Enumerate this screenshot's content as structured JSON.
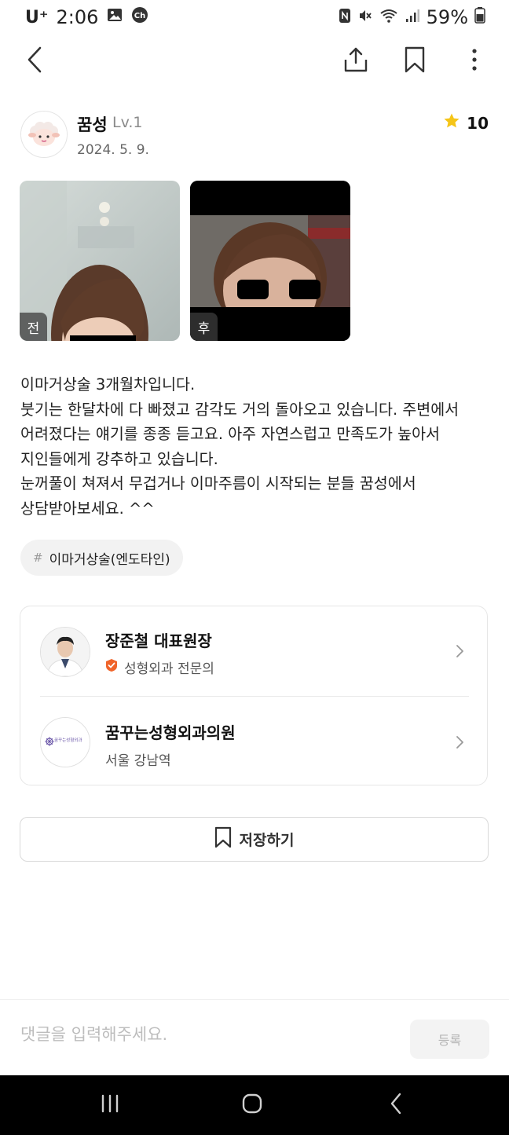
{
  "status_bar": {
    "carrier": "U⁺",
    "time": "2:06",
    "battery": "59%",
    "icons": [
      "gallery-icon",
      "channel-icon",
      "nfc-icon",
      "mute-icon",
      "wifi-icon",
      "signal-icon",
      "battery-icon"
    ]
  },
  "top_bar": {
    "icons": [
      "back-arrow-icon",
      "share-icon",
      "bookmark-icon",
      "more-vertical-icon"
    ]
  },
  "author": {
    "name": "꿈성",
    "level": "Lv.1",
    "date": "2024. 5. 9.",
    "avatar_icon": "sheep-avatar-icon"
  },
  "rating": {
    "value": "10",
    "icon": "star-icon",
    "color": "#F5C518"
  },
  "photos": [
    {
      "label": "전"
    },
    {
      "label": "후"
    }
  ],
  "body_lines": [
    "이마거상술 3개월차입니다.",
    "붓기는 한달차에 다 빠졌고 감각도 거의 돌아오고 있습니다. 주변에서",
    "어려졌다는 얘기를 종종 듣고요. 아주 자연스럽고 만족도가 높아서",
    "지인들에게 강추하고 있습니다.",
    "눈꺼풀이 쳐져서 무겁거나 이마주름이 시작되는 분들 꿈성에서",
    "상담받아보세요. ^^"
  ],
  "tag": {
    "hash": "#",
    "label": "이마거상술(엔도타인)"
  },
  "doctor": {
    "name": "장준철 대표원장",
    "specialty": "성형외과 전문의",
    "badge_color": "#F0642A"
  },
  "clinic": {
    "name": "꿈꾸는성형외과의원",
    "location": "서울 강남역",
    "logo_text": "꿈꾸는성형외과"
  },
  "save_button": {
    "label": "저장하기"
  },
  "comment": {
    "placeholder": "댓글을 입력해주세요.",
    "submit_label": "등록"
  },
  "nav_bar": {
    "icons": [
      "recent-apps-icon",
      "home-icon",
      "nav-back-icon"
    ]
  }
}
